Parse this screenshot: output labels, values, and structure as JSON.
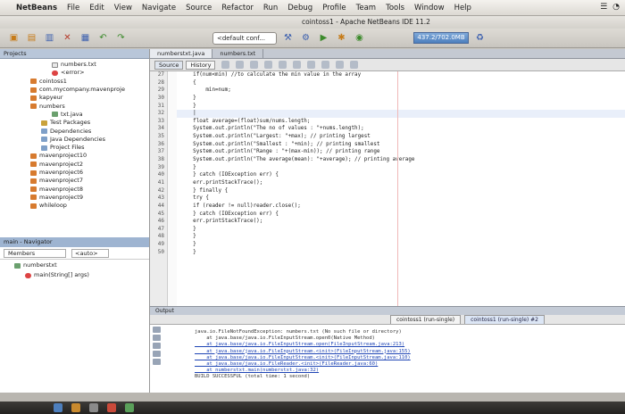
{
  "menubar": {
    "app": "NetBeans",
    "items": [
      "File",
      "Edit",
      "View",
      "Navigate",
      "Source",
      "Refactor",
      "Run",
      "Debug",
      "Profile",
      "Team",
      "Tools",
      "Window",
      "Help"
    ]
  },
  "window_title": "cointoss1 - Apache NetBeans IDE 11.2",
  "toolbar": {
    "config": "<default conf...",
    "memory": "437.2/702.0MB"
  },
  "projects": {
    "tab": "Projects",
    "tree": [
      {
        "label": "numbers.txt",
        "indent": 58,
        "icon": "file"
      },
      {
        "label": "<error>",
        "indent": 58,
        "icon": "err"
      },
      {
        "label": "cointoss1",
        "indent": 34,
        "icon": "cup"
      },
      {
        "label": "com.mycompany.mavenproje",
        "indent": 34,
        "icon": "cup"
      },
      {
        "label": "kapyeur",
        "indent": 34,
        "icon": "cup"
      },
      {
        "label": "numbers",
        "indent": 34,
        "icon": "cup"
      },
      {
        "label": "txt.java",
        "indent": 58,
        "icon": "java"
      },
      {
        "label": "Test Packages",
        "indent": 46,
        "icon": "pkg"
      },
      {
        "label": "Dependencies",
        "indent": 46,
        "icon": "lib"
      },
      {
        "label": "Java Dependencies",
        "indent": 46,
        "icon": "lib"
      },
      {
        "label": "Project Files",
        "indent": 46,
        "icon": "lib"
      },
      {
        "label": "mavenproject10",
        "indent": 34,
        "icon": "cup"
      },
      {
        "label": "mavenproject2",
        "indent": 34,
        "icon": "cup"
      },
      {
        "label": "mavenproject6",
        "indent": 34,
        "icon": "cup"
      },
      {
        "label": "mavenproject7",
        "indent": 34,
        "icon": "cup"
      },
      {
        "label": "mavenproject8",
        "indent": 34,
        "icon": "cup"
      },
      {
        "label": "mavenproject9",
        "indent": 34,
        "icon": "cup"
      },
      {
        "label": "whileloop",
        "indent": 34,
        "icon": "cup"
      }
    ]
  },
  "navigator": {
    "tab": "main - Navigator",
    "members": "Members",
    "filter": "<auto>",
    "items": [
      {
        "label": "numberstxt",
        "indent": 16
      },
      {
        "label": "main(String[] args)",
        "indent": 28
      }
    ]
  },
  "editor": {
    "tabs": [
      "numberstxt.java",
      "numbers.txt"
    ],
    "source_tab": "Source",
    "history_tab": "History",
    "lines": [
      {
        "n": "27",
        "text": "    if(num<min) //to calculate the min value in the array"
      },
      {
        "n": "28",
        "text": "    {"
      },
      {
        "n": "29",
        "text": "        min=num;"
      },
      {
        "n": "30",
        "text": "    }"
      },
      {
        "n": "31",
        "text": "    }"
      },
      {
        "n": "32",
        "text": "    |"
      },
      {
        "n": "33",
        "text": "    float average=(float)sum/nums.length;"
      },
      {
        "n": "34",
        "text": "    System.out.println(\"The no of values : \"+nums.length);"
      },
      {
        "n": "35",
        "text": "    System.out.println(\"Largest: \"+max); // printing largest"
      },
      {
        "n": "36",
        "text": "    System.out.println(\"Smallest : \"+min); // printing smallest"
      },
      {
        "n": "37",
        "text": "    System.out.println(\"Range : \"+(max-min)); // printing range"
      },
      {
        "n": "38",
        "text": "    System.out.println(\"The average(mean): \"+average); // printing average"
      },
      {
        "n": "39",
        "text": "    }"
      },
      {
        "n": "40",
        "text": "    } catch (IOException err) {"
      },
      {
        "n": "41",
        "text": "    err.printStackTrace();"
      },
      {
        "n": "42",
        "text": "    } finally {"
      },
      {
        "n": "43",
        "text": "    try {"
      },
      {
        "n": "44",
        "text": "    if (reader != null)reader.close();"
      },
      {
        "n": "45",
        "text": "    } catch (IOException err) {"
      },
      {
        "n": "46",
        "text": "    err.printStackTrace();"
      },
      {
        "n": "47",
        "text": "    }"
      },
      {
        "n": "48",
        "text": "    }"
      },
      {
        "n": "49",
        "text": "    }"
      },
      {
        "n": "50",
        "text": "    }"
      }
    ]
  },
  "output": {
    "header": "Output",
    "tabs": [
      "cointoss1 (run-single)",
      "cointoss1 (run-single) #2"
    ],
    "lines": [
      "java.io.FileNotFoundException: numbers.txt (No such file or directory)",
      "    at java.base/java.io.FileInputStream.open0(Native Method)",
      "    at java.base/java.io.FileInputStream.open(FileInputStream.java:213)",
      "    at java.base/java.io.FileInputStream.<init>(FileInputStream.java:155)",
      "    at java.base/java.io.FileInputStream.<init>(FileInputStream.java:110)",
      "    at java.base/java.io.FileReader.<init>(FileReader.java:60)",
      "    at numberstxt.main(numberstxt.java:32)",
      "BUILD SUCCESSFUL (total time: 1 second)"
    ]
  }
}
